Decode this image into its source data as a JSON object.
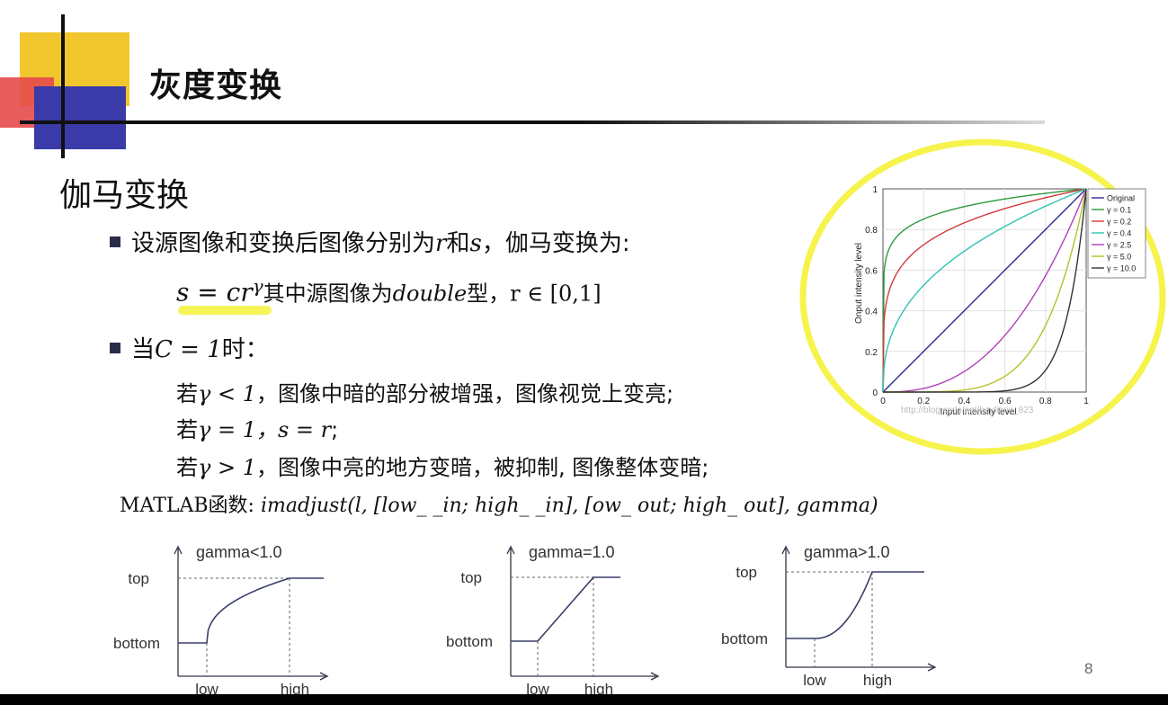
{
  "slide": {
    "title": "灰度变换",
    "heading": "伽马变换",
    "bullet1": {
      "text_a": "设源图像和变换后图像分别为",
      "r": "r",
      "and": "和",
      "s": "s",
      "text_b": "，伽马变换为:"
    },
    "formula": {
      "lhs": "s = cr",
      "exp": "γ",
      "text": "其中源图像为",
      "double": "double",
      "type": "型，",
      "range": "r ∈ [0,1]"
    },
    "bullet2": {
      "prefix": "当",
      "cond": "C = 1",
      "suffix": "时："
    },
    "cases": [
      {
        "prefix": "若",
        "cond": "γ < 1",
        "text": "，图像中暗的部分被增强，图像视觉上变亮;"
      },
      {
        "prefix": "若",
        "cond": "γ = 1，s = r",
        "text": ";"
      },
      {
        "prefix": "若",
        "cond": "γ >  1",
        "text": "，图像中亮的地方变暗，被抑制, 图像整体变暗;"
      }
    ],
    "matlab": {
      "prefix": "MATLAB函数: ",
      "func": "imadjust",
      "args": "(l, [low_ _in; high_ _in], [ow_ out; high_ out], gamma)"
    },
    "page_number": "8"
  },
  "gamma_plot": {
    "ylabel": "Onput intensity level",
    "xlabel": "Input intensity level",
    "watermark": "http://blog.csdn.net/huuliang_823",
    "y_ticks": [
      "0",
      "0.2",
      "0.4",
      "0.6",
      "0.8",
      "1"
    ],
    "x_ticks": [
      "0",
      "0.2",
      "0.4",
      "0.6",
      "0.8",
      "1"
    ],
    "highlight_color": "#f5f23a"
  },
  "chart_data": {
    "type": "line",
    "title": "",
    "xlabel": "Input intensity level",
    "ylabel": "Onput intensity level",
    "xlim": [
      0,
      1
    ],
    "ylim": [
      0,
      1
    ],
    "grid": true,
    "legend": "top-right",
    "series": [
      {
        "name": "Original",
        "gamma": 1.0,
        "color": "#2b2b8f"
      },
      {
        "name": "γ = 0.1",
        "gamma": 0.1,
        "color": "#2e9a3a"
      },
      {
        "name": "γ = 0.2",
        "gamma": 0.2,
        "color": "#d23a3a"
      },
      {
        "name": "γ = 0.4",
        "gamma": 0.4,
        "color": "#2fc3b3"
      },
      {
        "name": "γ = 2.5",
        "gamma": 2.5,
        "color": "#b040b8"
      },
      {
        "name": "γ = 5.0",
        "gamma": 5.0,
        "color": "#b8c02a"
      },
      {
        "name": "γ = 10.0",
        "gamma": 10.0,
        "color": "#333333"
      }
    ]
  },
  "mini_plots": [
    {
      "title": "gamma<1.0",
      "top": "top",
      "bottom": "bottom",
      "low": "low",
      "high": "high",
      "gamma": 0.4
    },
    {
      "title": "gamma=1.0",
      "top": "top",
      "bottom": "bottom",
      "low": "low",
      "high": "high",
      "gamma": 1.0
    },
    {
      "title": "gamma>1.0",
      "top": "top",
      "bottom": "bottom",
      "low": "low",
      "high": "high",
      "gamma": 2.2
    }
  ]
}
